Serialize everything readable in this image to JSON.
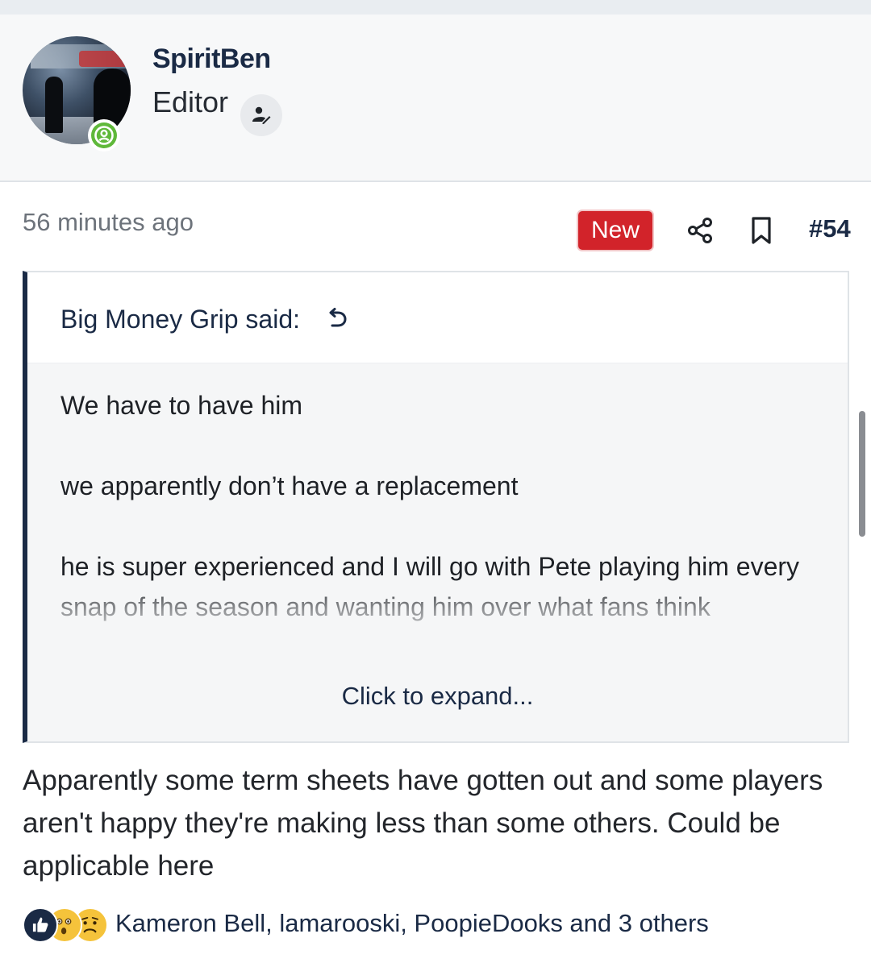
{
  "header": {
    "username": "SpiritBen",
    "role": "Editor",
    "avatar_icon": "user-avatar-photo",
    "online_icon": "online-status-icon",
    "role_icon": "editor-pencil-icon"
  },
  "post": {
    "time": "56 minutes ago",
    "new_badge": "New",
    "number": "#54",
    "icons": [
      "share-icon",
      "bookmark-icon"
    ]
  },
  "quote": {
    "author": "Big Money Grip said:",
    "paragraphs": [
      "We have to have him",
      "we apparently don’t have a replacement",
      "he is super experienced and I will go with Pete playing him every snap of the season and wanting him over what fans think"
    ],
    "expand_label": "Click to expand..."
  },
  "message": "Apparently some term sheets have gotten out and some players aren't happy they're making less than some others. Could be applicable here",
  "reactions": {
    "icons": [
      "like-icon",
      "wow-icon",
      "sad-icon"
    ],
    "summary": "Kameron Bell, lamarooski, PoopieDooks and 3 others"
  },
  "colors": {
    "brand_navy": "#1a2a45",
    "new_red": "#d2232a",
    "online_green": "#5fb83a"
  }
}
